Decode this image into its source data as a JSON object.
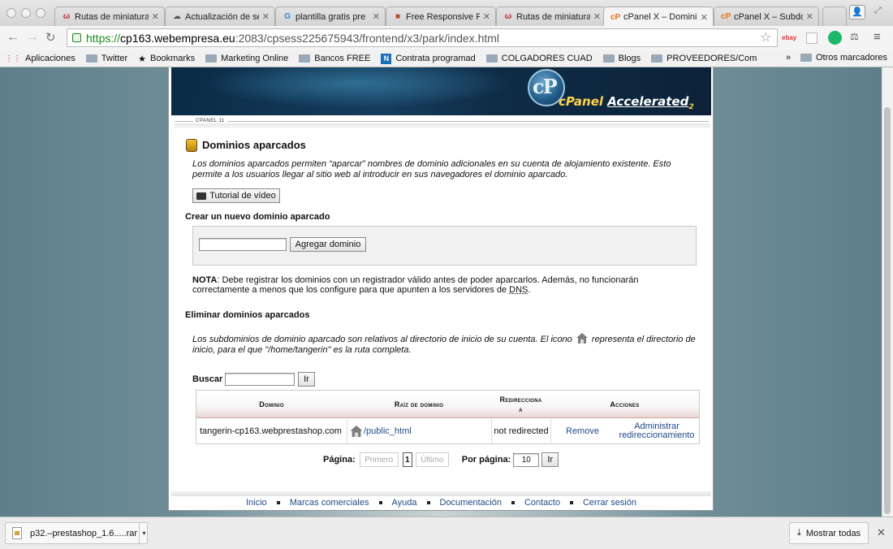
{
  "browser": {
    "tabs": [
      {
        "favicon": "ω",
        "title": "Rutas de miniatura"
      },
      {
        "favicon": "☁",
        "title": "Actualización de se"
      },
      {
        "favicon": "G",
        "title": "plantilla gratis pre"
      },
      {
        "favicon": "■",
        "title": "Free Responsive Pr"
      },
      {
        "favicon": "ω",
        "title": "Rutas de miniatura"
      },
      {
        "favicon": "cP",
        "title": "cPanel X – Dominic"
      },
      {
        "favicon": "cP",
        "title": "cPanel X – Subdom"
      }
    ],
    "url_scheme": "https://",
    "url_host": "cp163.webempresa.eu",
    "url_path": ":2083/cpsess225675943/frontend/x3/park/index.html",
    "bookmarks": [
      {
        "icon": "apps-icon",
        "label": "Aplicaciones"
      },
      {
        "icon": "folder-icon",
        "label": "Twitter"
      },
      {
        "icon": "star-icon",
        "label": "Bookmarks"
      },
      {
        "icon": "folder-icon",
        "label": "Marketing Online"
      },
      {
        "icon": "folder-icon",
        "label": "Bancos FREE"
      },
      {
        "icon": "n-icon",
        "label": "Contrata programad"
      },
      {
        "icon": "folder-icon",
        "label": "COLGADORES CUAD"
      },
      {
        "icon": "folder-icon",
        "label": "Blogs"
      },
      {
        "icon": "folder-icon",
        "label": "PROVEEDORES/Com"
      }
    ],
    "bookmarks_overflow": "»",
    "other_bookmarks": "Otros marcadores"
  },
  "cpanel": {
    "brand_cp": "cP",
    "brand_panel": "cPanel",
    "brand_accelerated": "Accelerated",
    "brand_sub": "2",
    "version": "CPANEL 11",
    "page_title": "Dominios aparcados",
    "intro": "Los dominios aparcados permiten “aparcar” nombres de dominio adicionales en su cuenta de alojamiento existente. Esto permite a los usuarios llegar al sitio web al introducir en sus navegadores el dominio aparcado.",
    "tutorial_button": "Tutorial de vídeo",
    "create_heading": "Crear un nuevo dominio aparcado",
    "domain_input_value": "",
    "add_button": "Agregar dominio",
    "nota_label": "NOTA",
    "nota_text": ": Debe registrar los dominios con un registrador válido antes de poder aparcarlos. Además, no funcionarán correctamente a menos que los configure para que apunten a los servidores de ",
    "nota_dns": "DNS",
    "nota_end": ".",
    "delete_heading": "Eliminar dominios aparcados",
    "subdomain_text_a": "Los subdominios de dominio aparcado son relativos al directorio de inicio de su cuenta. El icono",
    "subdomain_text_b": "representa el directorio de inicio, para el que \"/home/tangerin\" es la ruta completa.",
    "search_label": "Buscar",
    "search_value": "",
    "go_button": "Ir",
    "table": {
      "headers": [
        "Dominio",
        "Raíz de dominio",
        "Redirecciona",
        "a",
        "Acciones"
      ],
      "row": {
        "domain": "tangerin-cp163.webprestashop.com",
        "root": "/public_html",
        "redirect": "not redirected",
        "action_remove": "Remove",
        "action_manage": "Administrar redireccionamiento"
      }
    },
    "pager": {
      "label": "Página:",
      "first": "Primero",
      "current": "1",
      "last": "Último",
      "per_page_label": "Por página:",
      "per_page_value": "10",
      "go": "Ir"
    },
    "footer": [
      "Inicio",
      "Marcas comerciales",
      "Ayuda",
      "Documentación",
      "Contacto",
      "Cerrar sesión"
    ]
  },
  "downloads": {
    "file": "p32.–prestashop_1.6.....rar",
    "show_all": "Mostrar todas"
  }
}
